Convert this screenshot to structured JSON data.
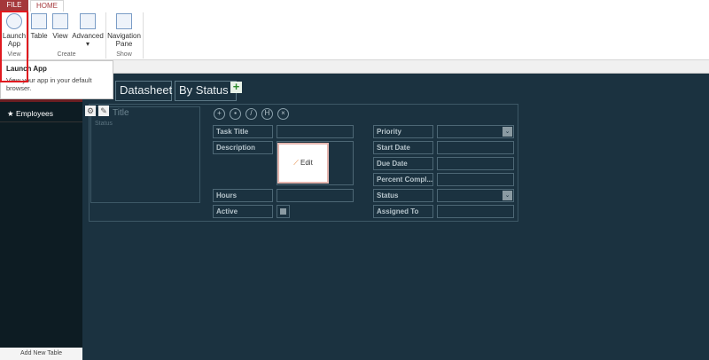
{
  "ribbon": {
    "tabs": {
      "file": "FILE",
      "home": "HOME"
    },
    "buttons": {
      "launch_app": "Launch App",
      "table": "Table",
      "view": "View",
      "advanced": "Advanced",
      "navigation_pane": "Navigation Pane"
    },
    "groups": {
      "view": "View",
      "create": "Create",
      "show": "Show"
    }
  },
  "tooltip": {
    "title": "Launch App",
    "text": "View your app in your default browser."
  },
  "nav": {
    "items": [
      {
        "label": "Employees"
      }
    ],
    "add_new_table": "Add New Table"
  },
  "views": {
    "tabs": [
      "Datasheet",
      "By Status"
    ]
  },
  "list": {
    "title": "Title",
    "subtitle": "Status"
  },
  "form": {
    "labels": {
      "task_title": "Task Title",
      "description": "Description",
      "hours": "Hours",
      "active": "Active",
      "priority": "Priority",
      "start_date": "Start Date",
      "due_date": "Due Date",
      "percent_complete": "Percent Compl...",
      "status": "Status",
      "assigned_to": "Assigned To"
    },
    "edit_label": "Edit"
  }
}
